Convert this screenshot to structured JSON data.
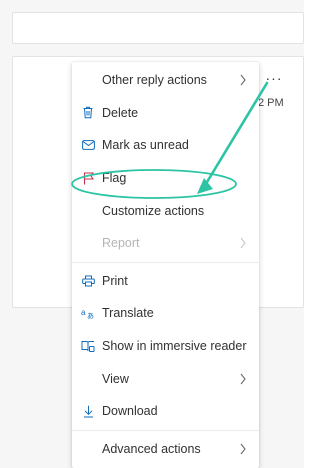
{
  "header": {
    "more_label": "···",
    "time_partial": "2 PM"
  },
  "menu": {
    "items": [
      {
        "label": "Other reply actions",
        "icon": "none",
        "submenu": true,
        "disabled": false
      },
      {
        "label": "Delete",
        "icon": "trash-icon",
        "submenu": false,
        "disabled": false
      },
      {
        "label": "Mark as unread",
        "icon": "envelope-icon",
        "submenu": false,
        "disabled": false
      },
      {
        "label": "Flag",
        "icon": "flag-icon",
        "submenu": false,
        "disabled": false
      },
      {
        "label": "Customize actions",
        "icon": "none",
        "submenu": false,
        "disabled": false,
        "highlighted": true
      },
      {
        "label": "Report",
        "icon": "none",
        "submenu": true,
        "disabled": true
      },
      {
        "label": "Print",
        "icon": "printer-icon",
        "submenu": false,
        "disabled": false
      },
      {
        "label": "Translate",
        "icon": "translate-icon",
        "submenu": false,
        "disabled": false
      },
      {
        "label": "Show in immersive reader",
        "icon": "immersive-reader-icon",
        "submenu": false,
        "disabled": false
      },
      {
        "label": "View",
        "icon": "none",
        "submenu": true,
        "disabled": false
      },
      {
        "label": "Download",
        "icon": "download-icon",
        "submenu": false,
        "disabled": false
      },
      {
        "label": "Advanced actions",
        "icon": "none",
        "submenu": true,
        "disabled": false
      }
    ]
  },
  "colors": {
    "annotation": "#2cc4a4",
    "flag": "#c4314b",
    "icon_blue": "#0f6cbd",
    "disabled_text": "#b5b5b5"
  }
}
